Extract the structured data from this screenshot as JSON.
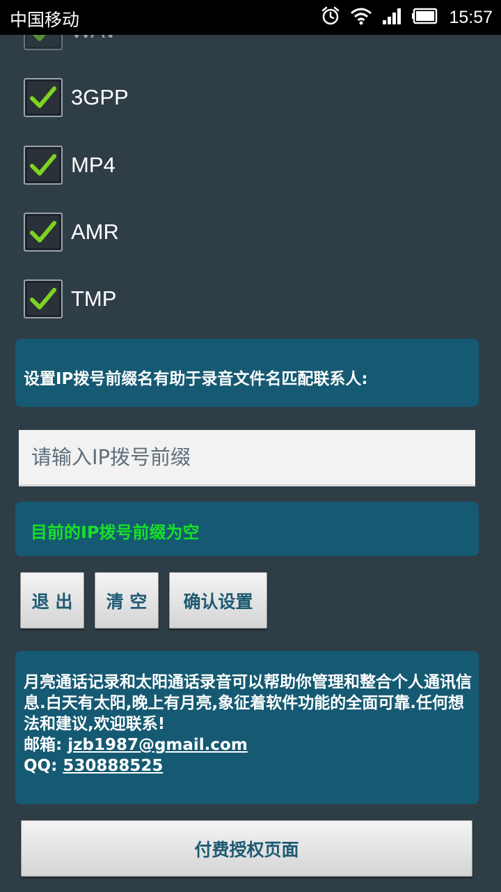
{
  "statusbar": {
    "carrier": "中国移动",
    "time": "15:57",
    "icons": [
      "alarm-icon",
      "wifi-icon",
      "signal-icon",
      "battery-icon"
    ]
  },
  "formats": [
    {
      "label": "WAV",
      "checked": true
    },
    {
      "label": "3GPP",
      "checked": true
    },
    {
      "label": "MP4",
      "checked": true
    },
    {
      "label": "AMR",
      "checked": true
    },
    {
      "label": "TMP",
      "checked": true
    }
  ],
  "ip_section": {
    "title": "设置IP拨号前缀名有助于录音文件名匹配联系人:",
    "input_placeholder": "请输入IP拨号前缀",
    "input_value": "",
    "status": "目前的IP拨号前缀为空"
  },
  "buttons": {
    "exit": "退 出",
    "clear": "清 空",
    "confirm": "确认设置"
  },
  "info": {
    "description": "月亮通话记录和太阳通话录音可以帮助你管理和整合个人通讯信息.白天有太阳,晚上有月亮,象征着软件功能的全面可靠.任何想法和建议,欢迎联系!",
    "email_label": "邮箱: ",
    "email": "jzb1987@gmail.com",
    "qq_label": "QQ: ",
    "qq": "530888525"
  },
  "paid_button": "付费授权页面",
  "colors": {
    "background": "#2f3d47",
    "panel": "#155a72",
    "status_green": "#18e028",
    "check_green": "#7ed321",
    "button_text": "#1e5a72"
  }
}
